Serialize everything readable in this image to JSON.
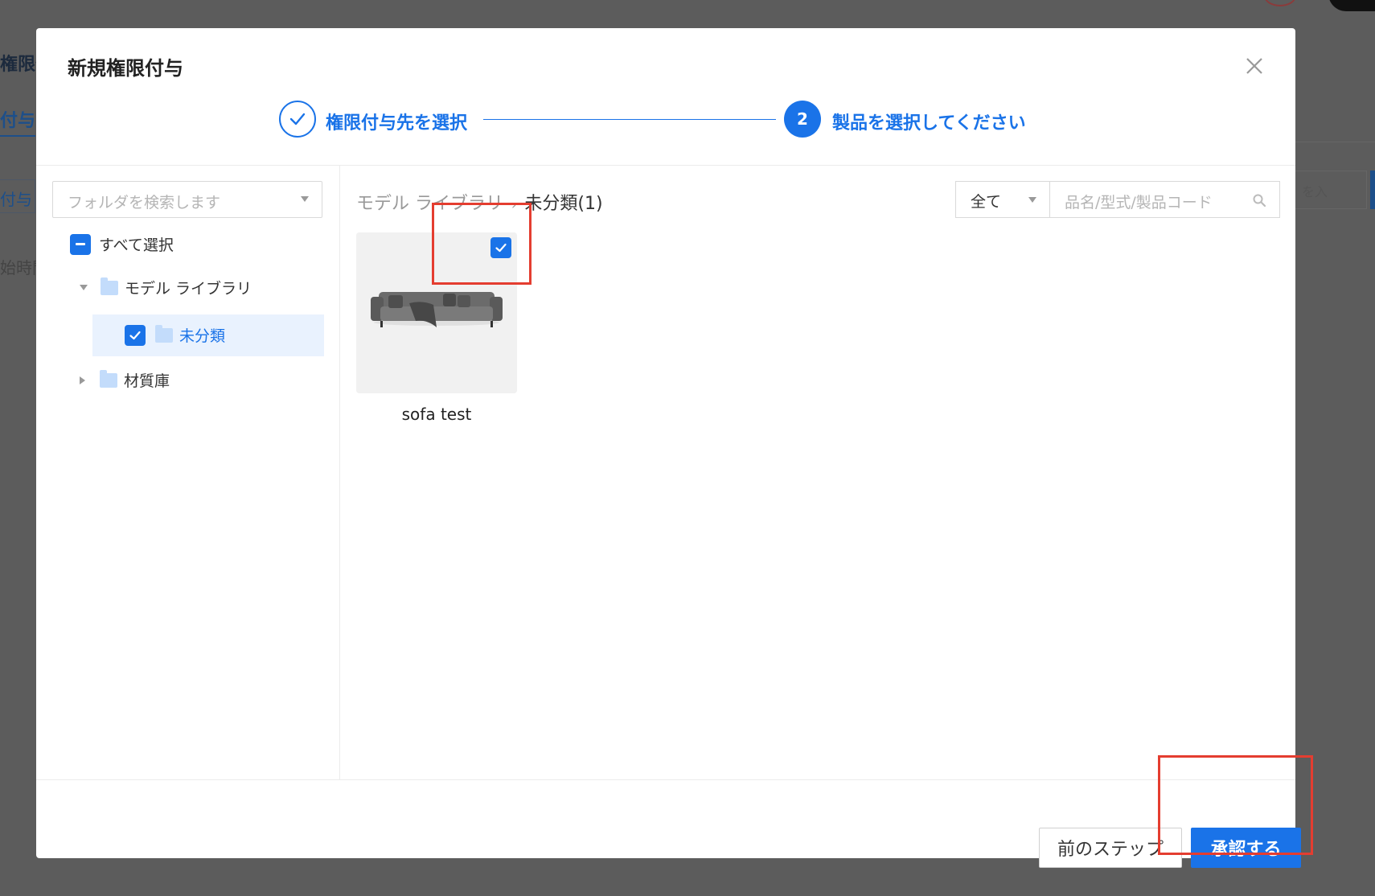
{
  "background": {
    "title_fragment": "権限付",
    "tab_fragment": "付与し",
    "filter_fragment": "付与",
    "time_fragment": "始時間",
    "right_input_fragment": "を入"
  },
  "modal": {
    "title": "新規権限付与",
    "steps": [
      {
        "number": "",
        "label": "権限付与先を選択",
        "status": "done"
      },
      {
        "number": "2",
        "label": "製品を選択してください",
        "status": "active"
      }
    ],
    "tree": {
      "search_placeholder": "フォルダを検索します",
      "select_all": "すべて選択",
      "folders": [
        {
          "label": "モデル ライブラリ",
          "expanded": true
        },
        {
          "label": "未分類",
          "checked": true,
          "selected": true
        },
        {
          "label": "材質庫",
          "expanded": false
        }
      ]
    },
    "breadcrumb": {
      "root": "モデル ライブラリ",
      "separator": "›",
      "current": "未分類(1)"
    },
    "filter": {
      "selected": "全て",
      "search_placeholder": "品名/型式/製品コード"
    },
    "products": [
      {
        "name": "sofa test",
        "checked": true
      }
    ],
    "buttons": {
      "prev": "前のステップ",
      "approve": "承認する"
    }
  },
  "colors": {
    "accent": "#1a73e8",
    "highlight": "#e43d30",
    "overlay": "#5c5c5c",
    "folder": "#c3dcfb"
  }
}
